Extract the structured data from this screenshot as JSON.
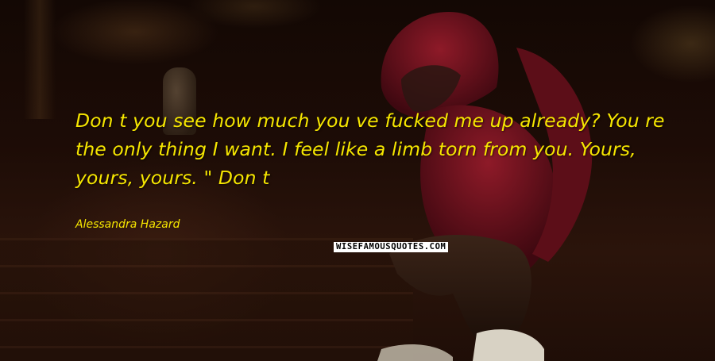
{
  "quote": {
    "text": "Don t you see how much you ve fucked me up already? You re the only thing I want. I feel like a limb torn from you. Yours, yours, yours. \" Don t",
    "author": "Alessandra Hazard"
  },
  "watermark": "WISEFAMOUSQUOTES.COM",
  "colors": {
    "quote_text": "#f6e600",
    "hoodie": "#7a1220"
  },
  "scene": {
    "subject": "person in red hoodie crouching on steps at night",
    "icons": [
      "hooded-person-figure"
    ]
  }
}
